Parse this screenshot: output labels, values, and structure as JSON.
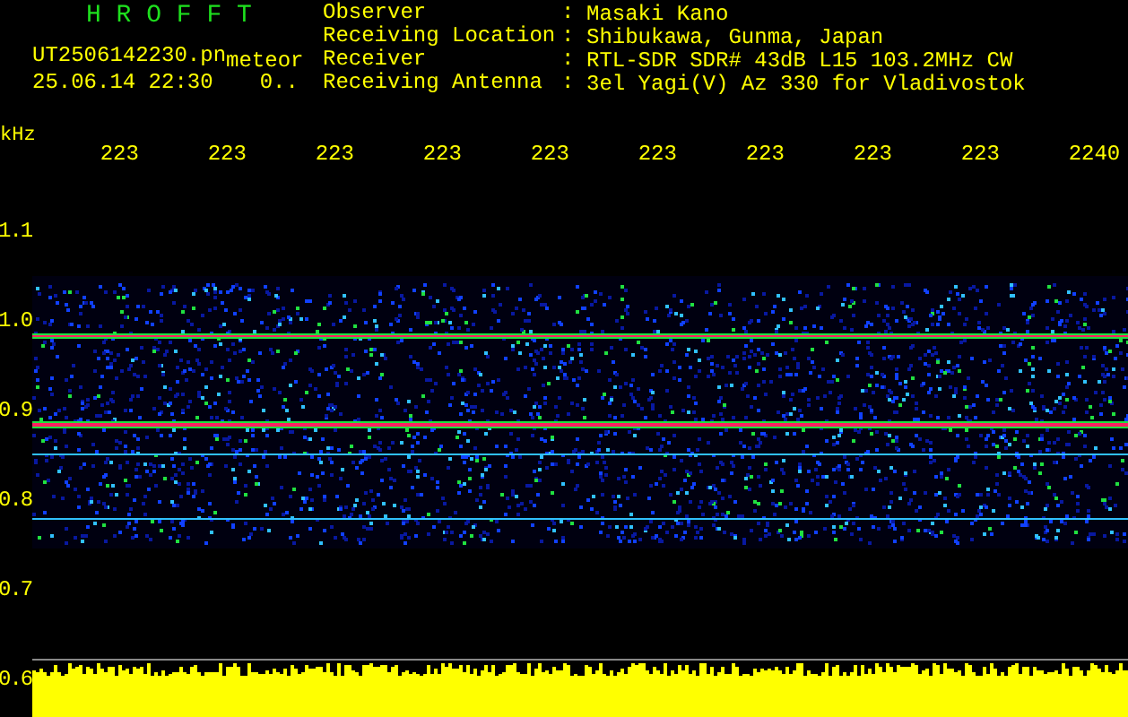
{
  "header": {
    "title": "H R O F F T",
    "file_name": "UT2506142230.pn",
    "file_note": "meteor",
    "datetime": "25.06.14 22:30",
    "counter": "0..",
    "info": [
      {
        "label": "Observer",
        "separator": ":",
        "value": "Masaki Kano"
      },
      {
        "label": "Receiving Location",
        "separator": ":",
        "value": "Shibukawa, Gunma, Japan"
      },
      {
        "label": "Receiver",
        "separator": ":",
        "value": "RTL-SDR SDR# 43dB L15 103.2MHz CW"
      },
      {
        "label": "Receiving Antenna",
        "separator": ":",
        "value": "3el Yagi(V) Az 330 for Vladivostok"
      }
    ]
  },
  "time_axis": {
    "labels": [
      "223",
      "223",
      "223",
      "223",
      "223",
      "223",
      "223",
      "223",
      "223",
      "2240"
    ]
  },
  "freq_axis": {
    "unit": "kHz",
    "labels": [
      "1.1",
      "1.0",
      "0.9",
      "0.8",
      "0.7",
      "0.6"
    ]
  }
}
